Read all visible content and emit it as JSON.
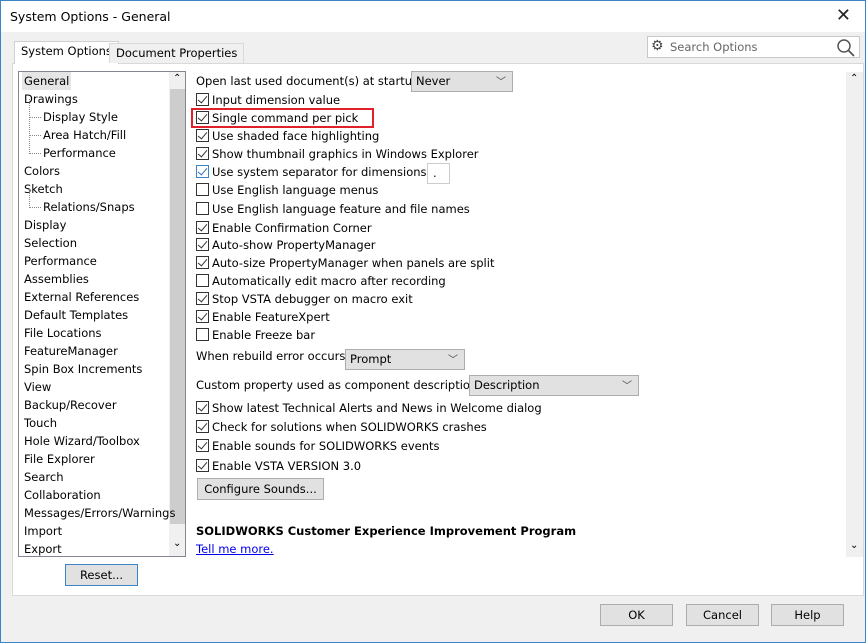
{
  "window": {
    "title": "System Options - General",
    "close_icon": "close-icon"
  },
  "tabs": [
    {
      "label": "System Options",
      "active": true
    },
    {
      "label": "Document Properties",
      "active": false
    }
  ],
  "search": {
    "placeholder": "Search Options",
    "icon": "search-icon",
    "settings_icon": "gear-icon"
  },
  "tree": {
    "selected": "General",
    "items": [
      {
        "label": "General",
        "level": 0
      },
      {
        "label": "Drawings",
        "level": 0
      },
      {
        "label": "Display Style",
        "level": 1
      },
      {
        "label": "Area Hatch/Fill",
        "level": 1
      },
      {
        "label": "Performance",
        "level": 1
      },
      {
        "label": "Colors",
        "level": 0
      },
      {
        "label": "Sketch",
        "level": 0
      },
      {
        "label": "Relations/Snaps",
        "level": 1
      },
      {
        "label": "Display",
        "level": 0
      },
      {
        "label": "Selection",
        "level": 0
      },
      {
        "label": "Performance",
        "level": 0
      },
      {
        "label": "Assemblies",
        "level": 0
      },
      {
        "label": "External References",
        "level": 0
      },
      {
        "label": "Default Templates",
        "level": 0
      },
      {
        "label": "File Locations",
        "level": 0
      },
      {
        "label": "FeatureManager",
        "level": 0
      },
      {
        "label": "Spin Box Increments",
        "level": 0
      },
      {
        "label": "View",
        "level": 0
      },
      {
        "label": "Backup/Recover",
        "level": 0
      },
      {
        "label": "Touch",
        "level": 0
      },
      {
        "label": "Hole Wizard/Toolbox",
        "level": 0
      },
      {
        "label": "File Explorer",
        "level": 0
      },
      {
        "label": "Search",
        "level": 0
      },
      {
        "label": "Collaboration",
        "level": 0
      },
      {
        "label": "Messages/Errors/Warnings",
        "level": 0
      },
      {
        "label": "Import",
        "level": 0
      },
      {
        "label": "Export",
        "level": 0
      }
    ]
  },
  "reset_label": "Reset...",
  "open_last": {
    "label": "Open last used document(s) at startup:",
    "value": "Never"
  },
  "options": [
    {
      "label": "Input dimension value",
      "checked": true
    },
    {
      "label": "Single command per pick",
      "checked": true,
      "highlighted": true
    },
    {
      "label": "Use shaded face highlighting",
      "checked": true
    },
    {
      "label": "Show thumbnail graphics in Windows Explorer",
      "checked": true
    },
    {
      "label": "Use system separator for dimensions",
      "checked": true,
      "focused": true
    },
    {
      "label": "Use English language menus",
      "checked": false
    },
    {
      "label": "Use English language feature and file names",
      "checked": false
    },
    {
      "label": "Enable Confirmation Corner",
      "checked": true
    },
    {
      "label": "Auto-show PropertyManager",
      "checked": true
    },
    {
      "label": "Auto-size PropertyManager when panels are split",
      "checked": true
    },
    {
      "label": "Automatically edit macro after recording",
      "checked": false
    },
    {
      "label": "Stop VSTA debugger on macro exit",
      "checked": true
    },
    {
      "label": "Enable FeatureXpert",
      "checked": true
    },
    {
      "label": "Enable Freeze bar",
      "checked": false
    }
  ],
  "separator_value": ".",
  "rebuild": {
    "label": "When rebuild error occurs:",
    "value": "Prompt"
  },
  "custom_prop": {
    "label": "Custom property used as component description:",
    "value": "Description"
  },
  "options2": [
    {
      "label": "Show latest Technical Alerts and News in Welcome dialog",
      "checked": true
    },
    {
      "label": "Check for solutions when SOLIDWORKS crashes",
      "checked": true
    },
    {
      "label": "Enable sounds for SOLIDWORKS events",
      "checked": true
    },
    {
      "label": "Enable VSTA VERSION 3.0",
      "checked": true
    }
  ],
  "configure_sounds": "Configure Sounds...",
  "ceip": {
    "heading": "SOLIDWORKS Customer Experience Improvement Program",
    "link": "Tell me more."
  },
  "footer": {
    "ok": "OK",
    "cancel": "Cancel",
    "help": "Help"
  },
  "colors": {
    "highlight": "#e0202a",
    "link": "#0000ee",
    "accent": "#3c84c8"
  }
}
